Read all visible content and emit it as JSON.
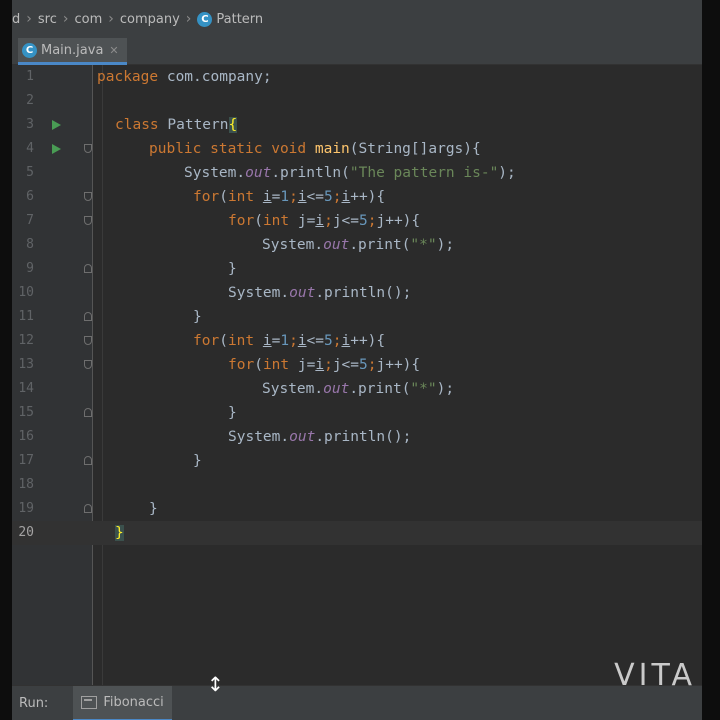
{
  "breadcrumb": {
    "items": [
      "d",
      "src",
      "com",
      "company"
    ],
    "file_class": "Pattern"
  },
  "tab": {
    "label": "Main.java"
  },
  "editor": {
    "line_numbers": [
      "1",
      "2",
      "3",
      "4",
      "5",
      "6",
      "7",
      "8",
      "9",
      "10",
      "11",
      "12",
      "13",
      "14",
      "15",
      "16",
      "17",
      "18",
      "19",
      "20"
    ],
    "current_line": "20"
  },
  "code": {
    "l1_kw": "package",
    "l1_rest": " com.company;",
    "l3_kw": "class",
    "l3_name": " Pattern",
    "l3_brace": "{",
    "l4_kw": "public static void",
    "l4_fn": " main",
    "l4_rest": "(String[]args){",
    "l5_a": "System.",
    "l5_out": "out",
    "l5_b": ".println(",
    "l5_str": "\"The pattern is-\"",
    "l5_c": ");",
    "for_kw": "for",
    "int_kw": "int",
    "l6_a": "(",
    "l6_b": " ",
    "l6_i": "i",
    "l6_eq": "=",
    "l6_1": "1",
    "l6_sc": ";",
    "l6_i2": "i",
    "l6_le": "<=",
    "l6_5": "5",
    "l6_sc2": ";",
    "l6_i3": "i",
    "l6_end": "++){",
    "l7_a": "(",
    "l7_b": " ",
    "l7_j": "j",
    "l7_eq": "=",
    "l7_i": "i",
    "l7_sc": ";",
    "l7_j2": "j",
    "l7_le": "<=",
    "l7_5": "5",
    "l7_sc2": ";",
    "l7_end": "j++){",
    "print_a": "System.",
    "print_out": "out",
    "print_b": ".print(",
    "print_str": "\"*\"",
    "print_c": ");",
    "close": "}",
    "println_a": "System.",
    "println_out": "out",
    "println_b": ".println();",
    "l20": "}"
  },
  "run_bar": {
    "label": "Run:",
    "tab": "Fibonacci"
  },
  "watermark": "VITA",
  "colors": {
    "background": "#2b2b2b",
    "keyword": "#cc7832",
    "string": "#6a8759",
    "number": "#6897bb",
    "field": "#9876aa",
    "method": "#ffc66d",
    "run_icon": "#499c54"
  }
}
